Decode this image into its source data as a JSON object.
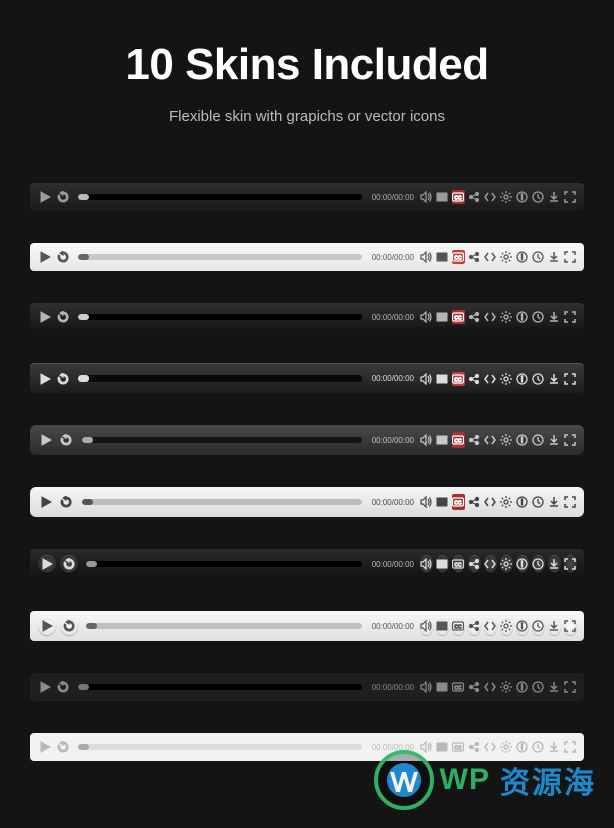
{
  "heading": "10 Skins Included",
  "subheading": "Flexible skin with grapichs or vector icons",
  "timecode": "00:00/00:00",
  "skins": [
    {
      "id": "skin-dark1",
      "style": "flat",
      "accent": true
    },
    {
      "id": "skin-light1",
      "style": "flat",
      "accent": true
    },
    {
      "id": "skin-dark2",
      "style": "flat",
      "accent": true
    },
    {
      "id": "skin-grad1",
      "style": "flat",
      "accent": true
    },
    {
      "id": "skin-mid",
      "style": "big",
      "accent": true
    },
    {
      "id": "skin-light2",
      "style": "big",
      "accent": true
    },
    {
      "id": "skin-round-dark",
      "style": "round",
      "accent": false
    },
    {
      "id": "skin-round-light",
      "style": "round",
      "accent": false
    },
    {
      "id": "skin-slim-dark",
      "style": "flat",
      "accent": false
    },
    {
      "id": "skin-slim-light",
      "style": "flat",
      "accent": false
    }
  ],
  "icons": {
    "play": "play-icon",
    "replay": "replay-icon",
    "volume": "volume-icon",
    "playlist": "playlist-icon",
    "cc": "captions-icon",
    "share": "share-icon",
    "embed": "embed-icon",
    "settings": "settings-icon",
    "info": "info-icon",
    "clock": "clock-icon",
    "download": "download-icon",
    "fullscreen": "fullscreen-icon"
  },
  "watermark": {
    "prefix": "WP",
    "suffix": "资源海"
  }
}
